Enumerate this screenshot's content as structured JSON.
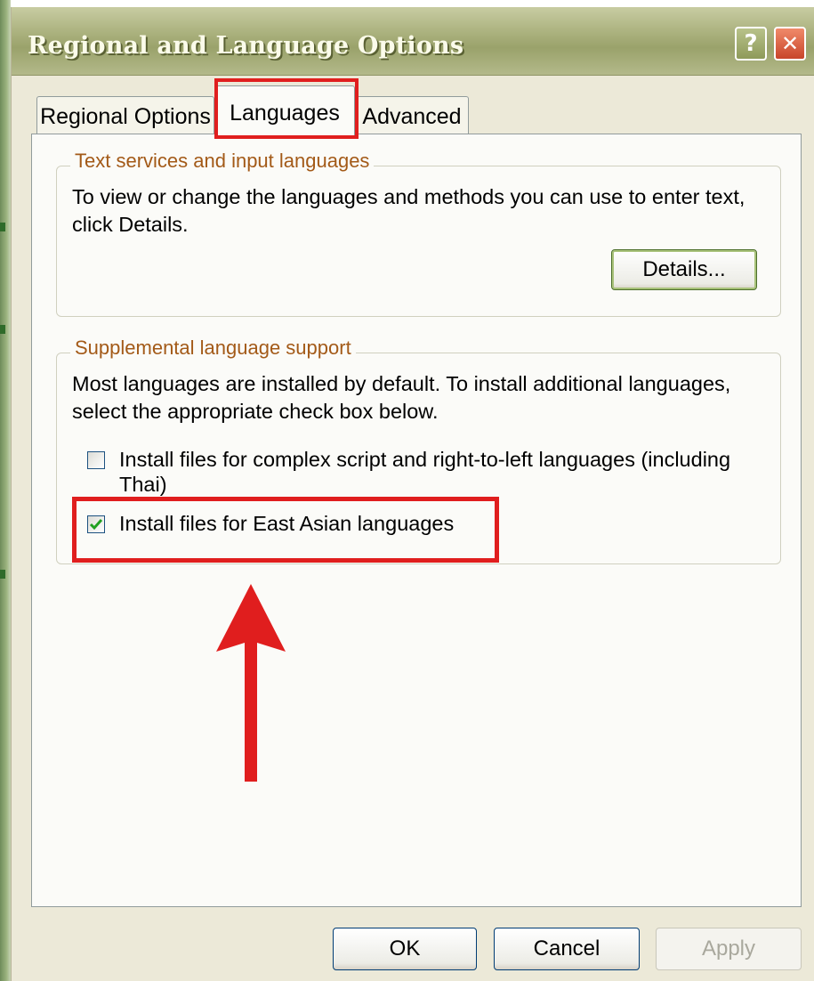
{
  "window": {
    "title": "Regional and Language Options",
    "help_glyph": "?",
    "close_glyph": "✕"
  },
  "tabs": [
    {
      "label": "Regional Options",
      "selected": false
    },
    {
      "label": "Languages",
      "selected": true
    },
    {
      "label": "Advanced",
      "selected": false
    }
  ],
  "text_services": {
    "legend": "Text services and input languages",
    "description": "To view or change the languages and methods you can use to enter text, click Details.",
    "details_button": "Details..."
  },
  "supplemental": {
    "legend": "Supplemental language support",
    "description": "Most languages are installed by default. To install additional languages, select the appropriate check box below.",
    "checkboxes": [
      {
        "label": "Install files for complex script and right-to-left languages (including Thai)",
        "checked": false
      },
      {
        "label": "Install files for East Asian languages",
        "checked": true
      }
    ]
  },
  "footer": {
    "ok_label": "OK",
    "cancel_label": "Cancel",
    "apply_label": "Apply",
    "apply_enabled": false
  },
  "annotations": {
    "highlight_color": "#e01e1e",
    "arrow_color": "#e01e1e"
  },
  "colors": {
    "dialog_bg": "#ece9d8",
    "legend_text": "#a35a18",
    "checkbox_check": "#21a121"
  }
}
